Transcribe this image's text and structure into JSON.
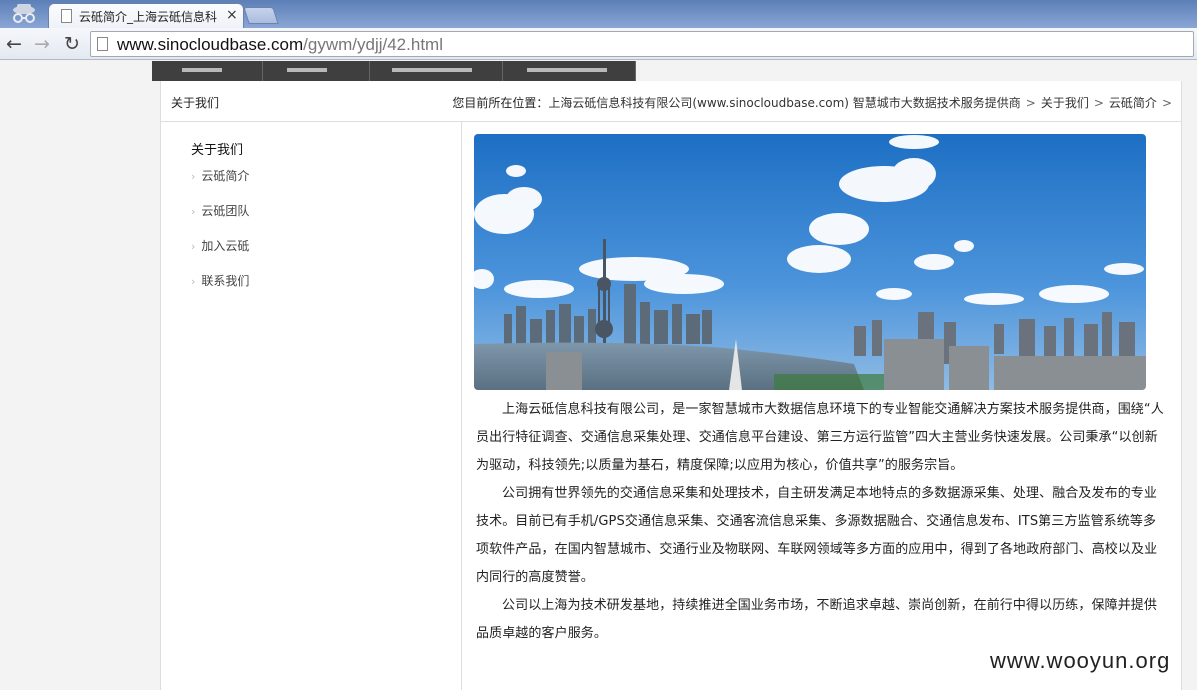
{
  "browser": {
    "tab_title": "云砥简介_上海云砥信息科",
    "tab_close": "×",
    "url_host": "www.sinocloudbase.com",
    "url_path": "/gywm/ydjj/42.html",
    "back_icon": "←",
    "forward_icon": "→",
    "reload_icon": "↻"
  },
  "page": {
    "section_title": "关于我们",
    "breadcrumb": {
      "prefix": "您目前所在位置：",
      "items": [
        "上海云砥信息科技有限公司(www.sinocloudbase.com) 智慧城市大数据技术服务提供商",
        "关于我们",
        "云砥简介"
      ],
      "separator": ">"
    },
    "sidebar": {
      "heading": "关于我们",
      "items": [
        "云砥简介",
        "云砥团队",
        "加入云砥",
        "联系我们"
      ]
    },
    "article": {
      "paragraphs": [
        "上海云砥信息科技有限公司，是一家智慧城市大数据信息环境下的专业智能交通解决方案技术服务提供商，围绕“人员出行特征调查、交通信息采集处理、交通信息平台建设、第三方运行监管”四大主营业务快速发展。公司秉承“以创新为驱动，科技领先;以质量为基石，精度保障;以应用为核心，价值共享”的服务宗旨。",
        "公司拥有世界领先的交通信息采集和处理技术，自主研发满足本地特点的多数据源采集、处理、融合及发布的专业技术。目前已有手机/GPS交通信息采集、交通客流信息采集、多源数据融合、交通信息发布、ITS第三方监管系统等多项软件产品，在国内智慧城市、交通行业及物联网、车联网领域等多方面的应用中，得到了各地政府部门、高校以及业内同行的高度赞誉。",
        "公司以上海为技术研发基地，持续推进全国业务市场，不断追求卓越、崇尚创新，在前行中得以历练，保障并提供品质卓越的客户服务。"
      ]
    }
  },
  "watermark": "www.wooyun.org",
  "colors": {
    "tabstrip": "#5c7fb8",
    "topnav": "#3f3f3f",
    "sky": "#3d86d4"
  }
}
